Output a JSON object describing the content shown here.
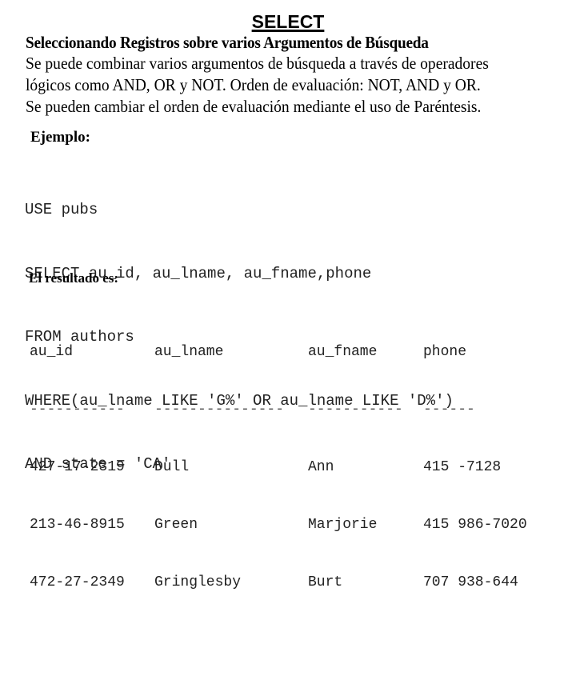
{
  "title": "SELECT",
  "subtitle": "Seleccionando Registros sobre varios Argumentos de Búsqueda",
  "paragraph": [
    "Se puede combinar varios argumentos de búsqueda a través de operadores",
    "lógicos como AND, OR y NOT.  Orden de evaluación: NOT, AND y OR.",
    "Se pueden cambiar el orden de evaluación mediante el uso de Paréntesis."
  ],
  "example_label": "Ejemplo:",
  "code": [
    "USE pubs",
    "SELECT au_id, au_lname, au_fname,phone",
    "FROM authors",
    "WHERE(au_lname LIKE 'G%' OR au_lname LIKE 'D%')",
    "AND state = 'CA'"
  ],
  "result_label": "El resultado es:",
  "result_table": {
    "headers": [
      "au_id",
      "au_lname",
      "au_fname",
      "phone"
    ],
    "separators": [
      "-----------",
      "---------------",
      "-----------",
      "------"
    ],
    "rows": [
      [
        "427-17-2319",
        "Dull",
        "Ann",
        "415 -7128"
      ],
      [
        "213-46-8915",
        "Green",
        "Marjorie",
        "415 986-7020"
      ],
      [
        "472-27-2349",
        "Gringlesby",
        "Burt",
        "707 938-644"
      ]
    ]
  }
}
